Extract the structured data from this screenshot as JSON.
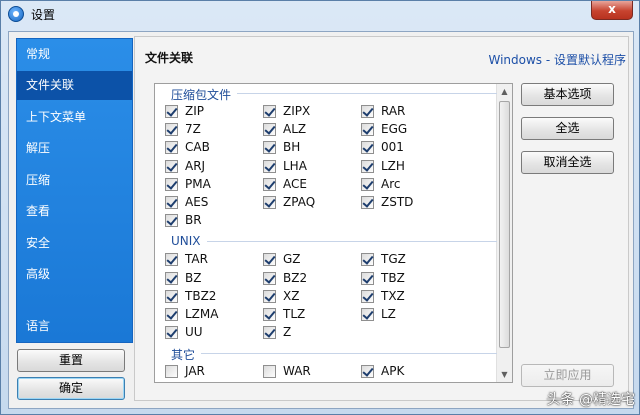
{
  "window": {
    "title": "设置",
    "close_label": "x"
  },
  "sidebar": {
    "items": [
      {
        "label": "常规",
        "active": false
      },
      {
        "label": "文件关联",
        "active": true
      },
      {
        "label": "上下文菜单",
        "active": false
      },
      {
        "label": "解压",
        "active": false
      },
      {
        "label": "压缩",
        "active": false
      },
      {
        "label": "查看",
        "active": false
      },
      {
        "label": "安全",
        "active": false
      },
      {
        "label": "高级",
        "active": false
      },
      {
        "label": "语言",
        "active": false
      }
    ],
    "reset_label": "重置",
    "ok_label": "确定"
  },
  "panel": {
    "title": "文件关联",
    "link": "Windows - 设置默认程序",
    "buttons": {
      "basic": "基本选项",
      "select_all": "全选",
      "deselect_all": "取消全选",
      "apply": "立即应用"
    },
    "groups": [
      {
        "label": "压缩包文件",
        "items": [
          {
            "label": "ZIP",
            "checked": true
          },
          {
            "label": "ZIPX",
            "checked": true
          },
          {
            "label": "RAR",
            "checked": true
          },
          {
            "label": "7Z",
            "checked": true
          },
          {
            "label": "ALZ",
            "checked": true
          },
          {
            "label": "EGG",
            "checked": true
          },
          {
            "label": "CAB",
            "checked": true
          },
          {
            "label": "BH",
            "checked": true
          },
          {
            "label": "001",
            "checked": true
          },
          {
            "label": "ARJ",
            "checked": true
          },
          {
            "label": "LHA",
            "checked": true
          },
          {
            "label": "LZH",
            "checked": true
          },
          {
            "label": "PMA",
            "checked": true
          },
          {
            "label": "ACE",
            "checked": true
          },
          {
            "label": "Arc",
            "checked": true
          },
          {
            "label": "AES",
            "checked": true
          },
          {
            "label": "ZPAQ",
            "checked": true
          },
          {
            "label": "ZSTD",
            "checked": true
          },
          {
            "label": "BR",
            "checked": true
          }
        ]
      },
      {
        "label": "UNIX",
        "items": [
          {
            "label": "TAR",
            "checked": true
          },
          {
            "label": "GZ",
            "checked": true
          },
          {
            "label": "TGZ",
            "checked": true
          },
          {
            "label": "BZ",
            "checked": true
          },
          {
            "label": "BZ2",
            "checked": true
          },
          {
            "label": "TBZ",
            "checked": true
          },
          {
            "label": "TBZ2",
            "checked": true
          },
          {
            "label": "XZ",
            "checked": true
          },
          {
            "label": "TXZ",
            "checked": true
          },
          {
            "label": "LZMA",
            "checked": true
          },
          {
            "label": "TLZ",
            "checked": true
          },
          {
            "label": "LZ",
            "checked": true
          },
          {
            "label": "UU",
            "checked": true
          },
          {
            "label": "Z",
            "checked": true
          }
        ]
      },
      {
        "label": "其它",
        "items": [
          {
            "label": "JAR",
            "checked": false
          },
          {
            "label": "WAR",
            "checked": false
          },
          {
            "label": "APK",
            "checked": true
          }
        ]
      }
    ]
  },
  "watermark": "头条 @精选宅"
}
